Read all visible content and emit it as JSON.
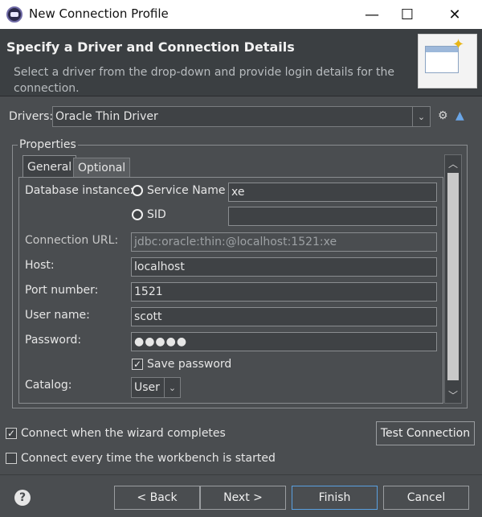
{
  "window": {
    "title": "New Connection Profile",
    "controls": {
      "minimize": "—",
      "maximize": "☐",
      "close": "✕"
    }
  },
  "banner": {
    "title": "Specify a Driver and Connection Details",
    "description": "Select a driver from the drop-down and provide login details for the connection."
  },
  "drivers": {
    "label": "Drivers:",
    "selected": "Oracle Thin Driver"
  },
  "properties": {
    "legend": "Properties",
    "tabs": [
      {
        "label": "General",
        "active": true
      },
      {
        "label": "Optional",
        "active": false
      }
    ],
    "general": {
      "database_instance_label": "Database instance:",
      "service_name_label": "Service Name",
      "service_name_value": "xe",
      "sid_label": "SID",
      "sid_value": "",
      "connection_url_label": "Connection URL:",
      "connection_url_value": "jdbc:oracle:thin:@localhost:1521:xe",
      "host_label": "Host:",
      "host_value": "localhost",
      "port_label": "Port number:",
      "port_value": "1521",
      "user_label": "User name:",
      "user_value": "scott",
      "password_label": "Password:",
      "password_value": "●●●●●",
      "save_password_label": "Save password",
      "save_password_checked": true,
      "catalog_label": "Catalog:",
      "catalog_value": "User"
    }
  },
  "options": {
    "connect_on_complete_label": "Connect when the wizard completes",
    "connect_on_complete_checked": true,
    "connect_every_time_label": "Connect every time the workbench is started",
    "connect_every_time_checked": false
  },
  "buttons": {
    "test_connection": "Test Connection",
    "back": "< Back",
    "next": "Next >",
    "finish": "Finish",
    "cancel": "Cancel"
  },
  "icons": {
    "new_driver": "gear-plus-icon",
    "edit_driver": "triangle-icon",
    "help": "question-icon"
  }
}
